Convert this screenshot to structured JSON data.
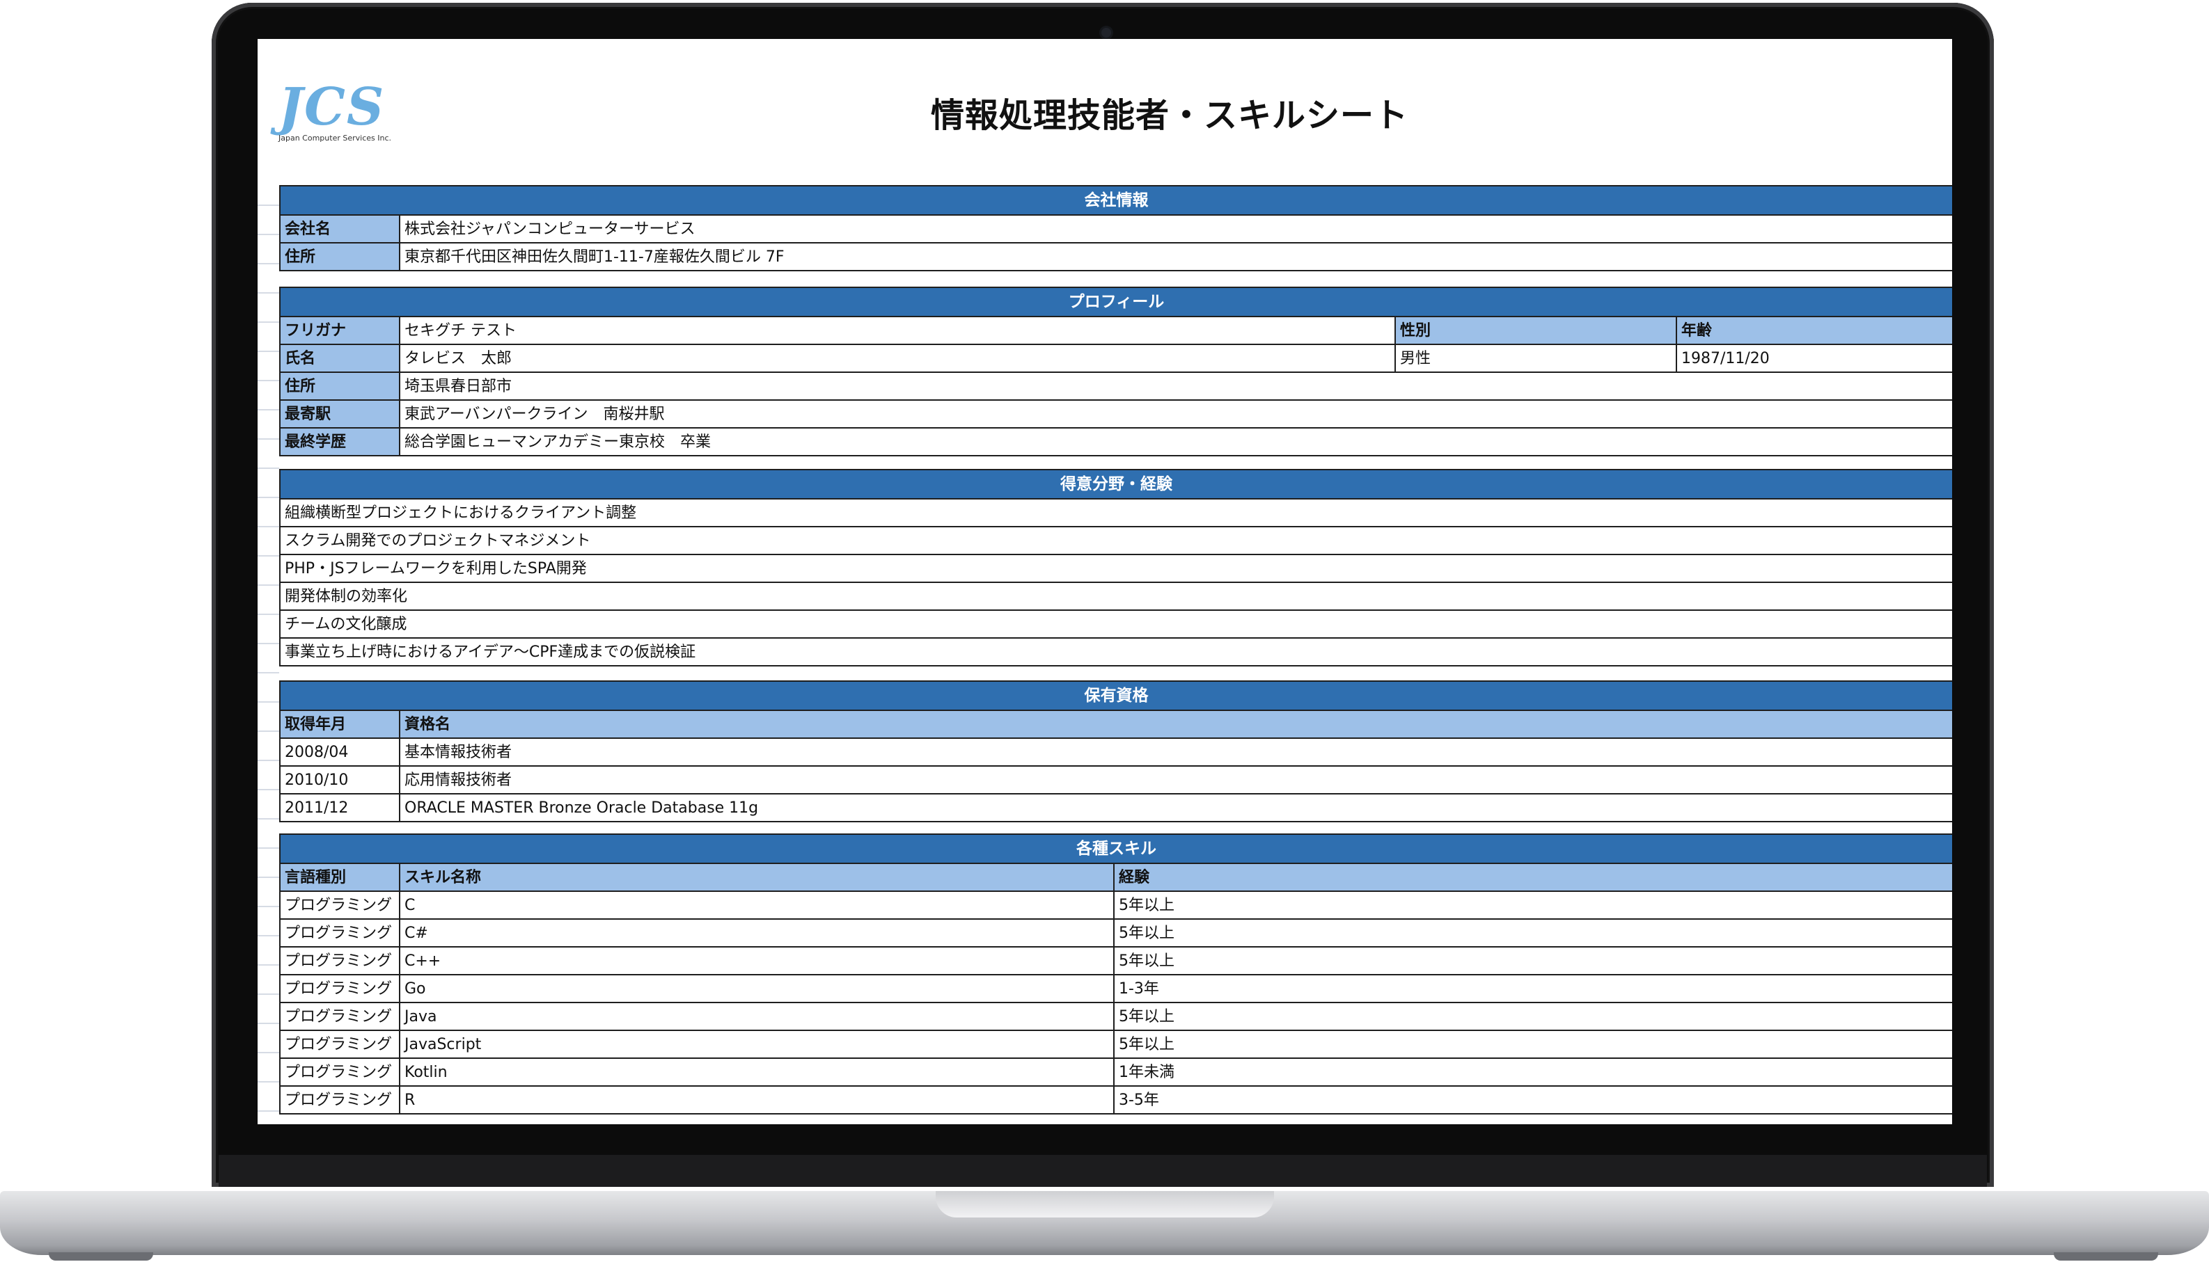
{
  "logo": {
    "mark": "JCS",
    "company": "Japan Computer Services Inc."
  },
  "title": "情報処理技能者・スキルシート",
  "company": {
    "header": "会社情報",
    "rows": [
      {
        "label": "会社名",
        "value": "株式会社ジャパンコンピューターサービス"
      },
      {
        "label": "住所",
        "value": "東京都千代田区神田佐久間町1-11-7産報佐久間ビル 7F"
      }
    ]
  },
  "profile": {
    "header": "プロフィール",
    "furigana_label": "フリガナ",
    "furigana": "セキグチ テスト",
    "gender_label": "性別",
    "age_label": "年齢",
    "name_label": "氏名",
    "name": "タレビス　太郎",
    "gender": "男性",
    "birthdate": "1987/11/20",
    "address_label": "住所",
    "address": "埼玉県春日部市",
    "station_label": "最寄駅",
    "station": "東武アーバンパークライン　南桜井駅",
    "education_label": "最終学歴",
    "education": "総合学園ヒューマンアカデミー東京校　卒業"
  },
  "expertise": {
    "header": "得意分野・経験",
    "items": [
      "組織横断型プロジェクトにおけるクライアント調整",
      "スクラム開発でのプロジェクトマネジメント",
      "PHP・JSフレームワークを利用したSPA開発",
      "開発体制の効率化",
      "チームの文化醸成",
      "事業立ち上げ時におけるアイデア〜CPF達成までの仮説検証"
    ]
  },
  "certifications": {
    "header": "保有資格",
    "col_date": "取得年月",
    "col_name": "資格名",
    "rows": [
      {
        "date": "2008/04",
        "name": "基本情報技術者"
      },
      {
        "date": "2010/10",
        "name": "応用情報技術者"
      },
      {
        "date": "2011/12",
        "name": "ORACLE MASTER Bronze Oracle Database 11g"
      }
    ]
  },
  "skills": {
    "header": "各種スキル",
    "col_type": "言語種別",
    "col_name": "スキル名称",
    "col_exp": "経験",
    "rows": [
      {
        "type": "プログラミング",
        "name": "C",
        "exp": "5年以上"
      },
      {
        "type": "プログラミング",
        "name": "C#",
        "exp": "5年以上"
      },
      {
        "type": "プログラミング",
        "name": "C++",
        "exp": "5年以上"
      },
      {
        "type": "プログラミング",
        "name": "Go",
        "exp": "1-3年"
      },
      {
        "type": "プログラミング",
        "name": "Java",
        "exp": "5年以上"
      },
      {
        "type": "プログラミング",
        "name": "JavaScript",
        "exp": "5年以上"
      },
      {
        "type": "プログラミング",
        "name": "Kotlin",
        "exp": "1年未満"
      },
      {
        "type": "プログラミング",
        "name": "R",
        "exp": "3-5年"
      }
    ]
  }
}
